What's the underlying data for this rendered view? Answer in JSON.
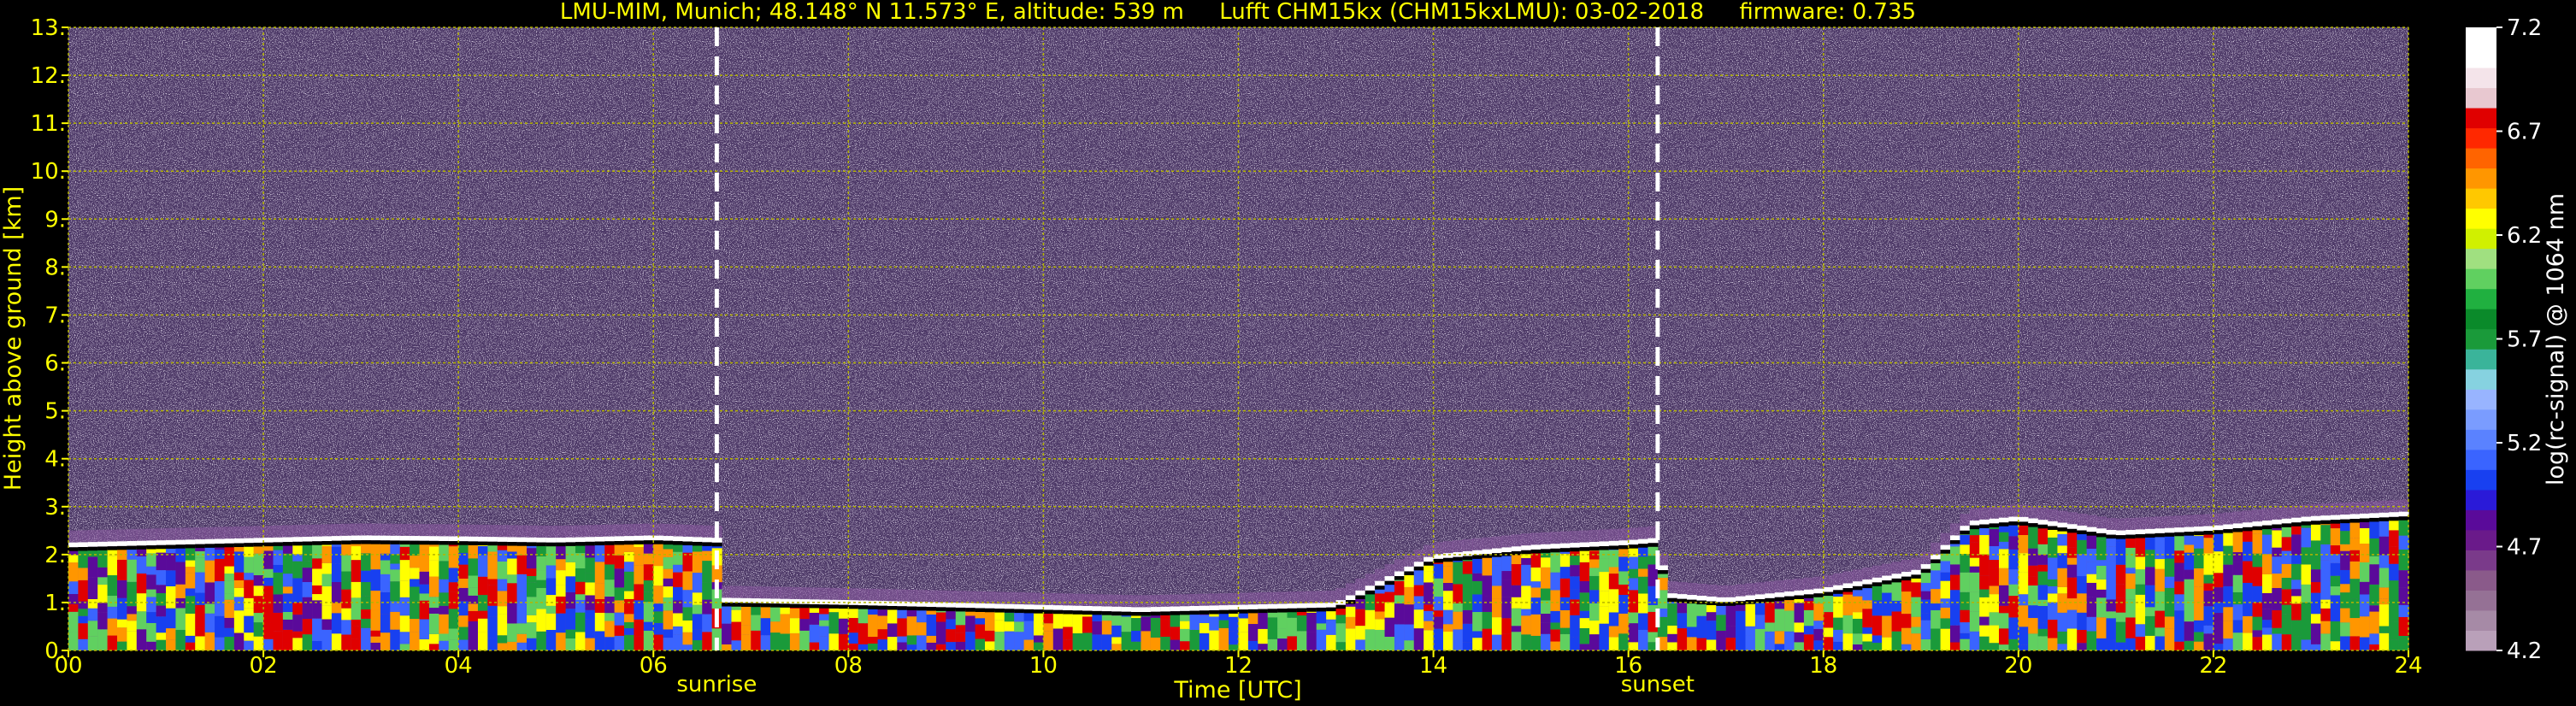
{
  "colors": {
    "background": "#000000",
    "text": "#ffff00",
    "colorbar_text": "#ffffff",
    "grid": "#b5b500",
    "event_line": "#ffffff",
    "sky_noise": "#4e3a68"
  },
  "chart_data": {
    "type": "heatmap",
    "title": "LMU-MIM, Munich; 48.148° N 11.573° E, altitude: 539 m     Lufft CHM15kx (CHM15kxLMU): 03-02-2018     firmware: 0.735",
    "xlabel": "Time [UTC]",
    "ylabel": "Height above ground [km]",
    "xlim": [
      0,
      24
    ],
    "ylim": [
      0,
      13
    ],
    "x_ticks": [
      0,
      2,
      4,
      6,
      8,
      10,
      12,
      14,
      16,
      18,
      20,
      22,
      24
    ],
    "x_tick_labels": [
      "00",
      "02",
      "04",
      "06",
      "08",
      "10",
      "12",
      "14",
      "16",
      "18",
      "20",
      "22",
      "24"
    ],
    "y_ticks": [
      0,
      1,
      2,
      3,
      4,
      5,
      6,
      7,
      8,
      9,
      10,
      11,
      12,
      13
    ],
    "y_tick_labels": [
      "0.",
      "1.",
      "2.",
      "3.",
      "4.",
      "5.",
      "6.",
      "7.",
      "8.",
      "9.",
      "10.",
      "11.",
      "12.",
      "13."
    ],
    "grid": true,
    "events": [
      {
        "label": "sunrise",
        "time": 6.65
      },
      {
        "label": "sunset",
        "time": 16.3
      }
    ],
    "boundary_layer_top_km": [
      [
        0,
        2.15
      ],
      [
        1,
        2.2
      ],
      [
        2,
        2.25
      ],
      [
        3,
        2.3
      ],
      [
        4,
        2.28
      ],
      [
        5,
        2.25
      ],
      [
        6,
        2.3
      ],
      [
        6.65,
        2.25
      ],
      [
        6.7,
        1.0
      ],
      [
        8,
        0.95
      ],
      [
        9,
        0.9
      ],
      [
        10,
        0.85
      ],
      [
        11,
        0.8
      ],
      [
        12,
        0.85
      ],
      [
        13,
        0.9
      ],
      [
        14,
        1.9
      ],
      [
        15,
        2.1
      ],
      [
        16,
        2.2
      ],
      [
        16.3,
        2.25
      ],
      [
        16.4,
        1.1
      ],
      [
        17,
        1.0
      ],
      [
        18,
        1.2
      ],
      [
        19,
        1.6
      ],
      [
        19.5,
        2.6
      ],
      [
        20,
        2.7
      ],
      [
        21,
        2.4
      ],
      [
        22,
        2.5
      ],
      [
        23,
        2.7
      ],
      [
        24,
        2.8
      ]
    ],
    "colorbar": {
      "label": "log(rc-signal) @ 1064 nm",
      "min": 4.2,
      "max": 7.2,
      "ticks": [
        "7.2",
        "6.7",
        "6.2",
        "5.7",
        "5.2",
        "4.7",
        "4.2"
      ],
      "colors": [
        "#b9a0b9",
        "#a68aa6",
        "#957195",
        "#8a5a8a",
        "#7a3a8a",
        "#6a1a8a",
        "#5a0a9a",
        "#2a1ad8",
        "#1840f0",
        "#3a64ff",
        "#5a82ff",
        "#7a9cff",
        "#98b4ff",
        "#86d2e0",
        "#3ab49a",
        "#1a9a3a",
        "#0a8a2a",
        "#20b040",
        "#60d060",
        "#a0e080",
        "#d0f000",
        "#ffff00",
        "#ffc800",
        "#ff9600",
        "#ff6400",
        "#ff2800",
        "#e00000",
        "#e8c8d0",
        "#f4e4ea",
        "#ffffff",
        "#ffffff"
      ]
    }
  }
}
